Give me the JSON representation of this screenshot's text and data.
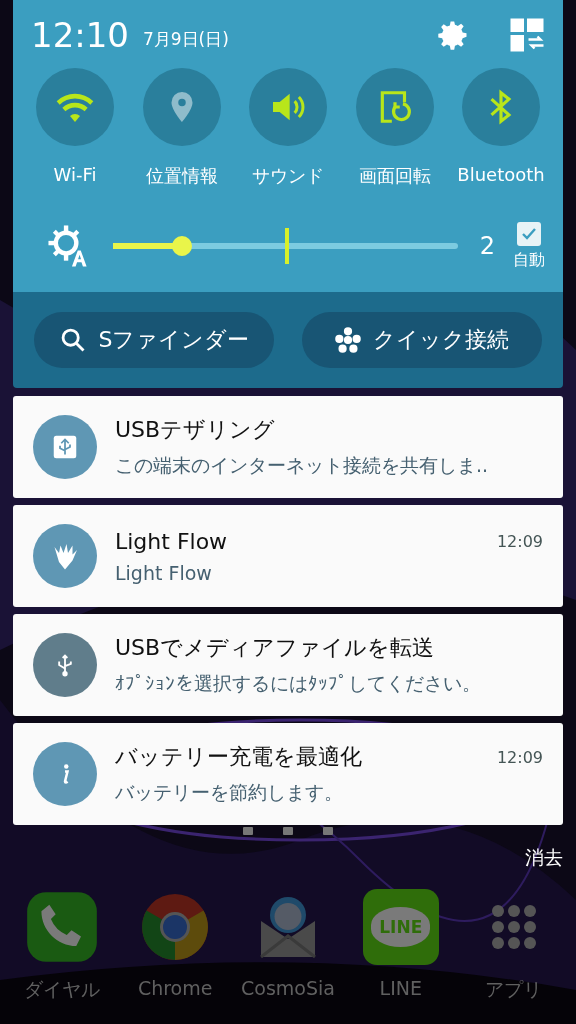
{
  "header": {
    "time": "12:10",
    "date": "7月9日(日)"
  },
  "toggles": [
    {
      "kind": "wifi",
      "label": "Wi-Fi",
      "on": true
    },
    {
      "kind": "location",
      "label": "位置情報",
      "on": false
    },
    {
      "kind": "sound",
      "label": "サウンド",
      "on": true
    },
    {
      "kind": "rotation",
      "label": "画面回転",
      "on": true
    },
    {
      "kind": "bluetooth",
      "label": "Bluetooth",
      "on": true
    }
  ],
  "brightness": {
    "level": 0.2,
    "reading": "2",
    "auto": {
      "label": "自動",
      "checked": true
    }
  },
  "buttons": [
    {
      "kind": "search",
      "label": "Sファインダー"
    },
    {
      "kind": "connect",
      "label": "クイック接続"
    }
  ],
  "notifications": [
    {
      "kind": "usb-tether",
      "title": "USBテザリング",
      "text": "この端末のインターネット接続を共有しま.."
    },
    {
      "kind": "lightflow",
      "title": "Light Flow",
      "text": "Light Flow",
      "time": "12:09"
    },
    {
      "kind": "usb",
      "title": "USBでメディアファイルを転送",
      "text": "ｵﾌﾟｼｮﾝを選択するにはﾀｯﾌﾟしてください。"
    },
    {
      "kind": "info",
      "title": "バッテリー充電を最適化",
      "text": "バッテリーを節約します。",
      "time": "12:09"
    }
  ],
  "clear": "消去",
  "dock": [
    {
      "kind": "phone",
      "label": "ダイヤル"
    },
    {
      "kind": "chrome",
      "label": "Chrome"
    },
    {
      "kind": "mail",
      "label": "CosmoSia"
    },
    {
      "kind": "line",
      "label": "LINE",
      "logo": "LINE"
    },
    {
      "kind": "apps",
      "label": "アプリ"
    }
  ]
}
